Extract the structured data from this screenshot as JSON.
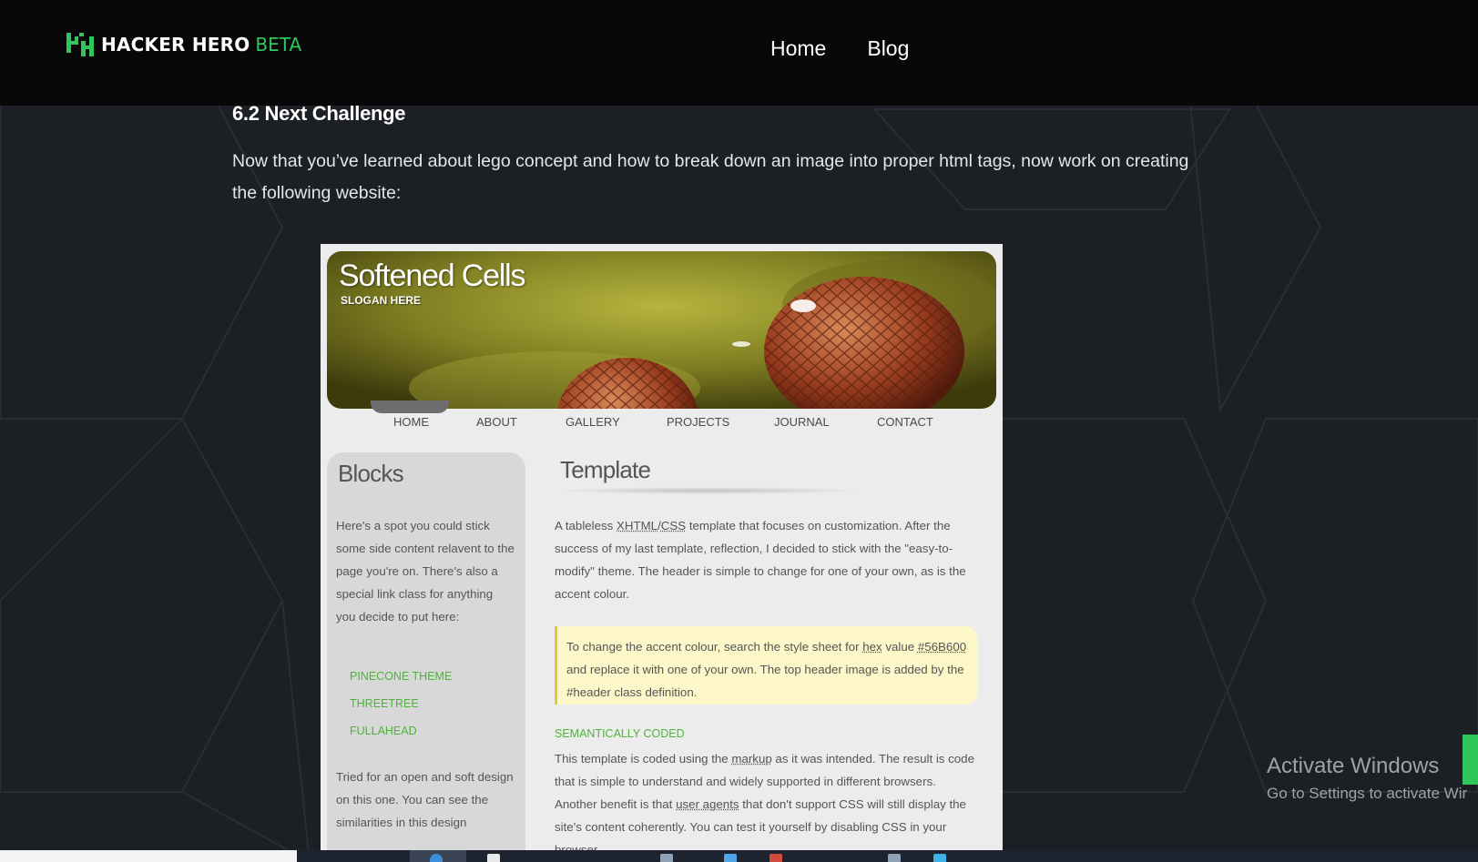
{
  "brand": {
    "name": "HACKER HERO",
    "tag": "BETA",
    "accent": "#2fc65c"
  },
  "nav": {
    "items": [
      "Home",
      "Blog"
    ]
  },
  "article": {
    "heading": "6.2 Next Challenge",
    "paragraph": "Now that you’ve learned about lego concept and how to break down an image into proper html tags, now work on creating the following website:"
  },
  "example_site": {
    "title": "Softened Cells",
    "slogan": "SLOGAN HERE",
    "menu": [
      "HOME",
      "ABOUT",
      "GALLERY",
      "PROJECTS",
      "JOURNAL",
      "CONTACT"
    ],
    "sidebar": {
      "title": "Blocks",
      "text": "Here's a spot you could stick some side content relavent to the page you're on. There's also a special link class for anything you decide to put here:",
      "links": [
        "PINECONE THEME",
        "THREETREE",
        "FULLAHEAD"
      ],
      "text2": "Tried for an open and soft design on this one. You can see the similarities in this design"
    },
    "main": {
      "title": "Template",
      "p1_a": "A tableless ",
      "p1_xhtml": "XHTML",
      "p1_slash": "/",
      "p1_css": "CSS",
      "p1_b": " template that focuses on customization. After the success of my last template, reflection, I decided to stick with the \"easy-to-modify\" theme. The header is simple to change for one of your own, as is the accent colour.",
      "note_a": "To change the accent colour, search the style sheet for ",
      "note_hex": "hex",
      "note_b": " value ",
      "note_code": "#56B600",
      "note_c": " and replace it with one of your own. The top header image is added by the #header class definition.",
      "section_head": "SEMANTICALLY CODED",
      "p2_a": "This template is coded using the ",
      "p2_markup": "markup",
      "p2_b": " as it was intended. The result is code that is simple to understand and widely supported in different browsers. Another benefit is that ",
      "p2_agents": "user agents",
      "p2_c": " that don't support CSS will still display the site's content coherently. You can test it yourself by disabling CSS in your browser."
    }
  },
  "watermark": {
    "line1": "Activate Windows",
    "line2": "Go to Settings to activate Wir"
  }
}
